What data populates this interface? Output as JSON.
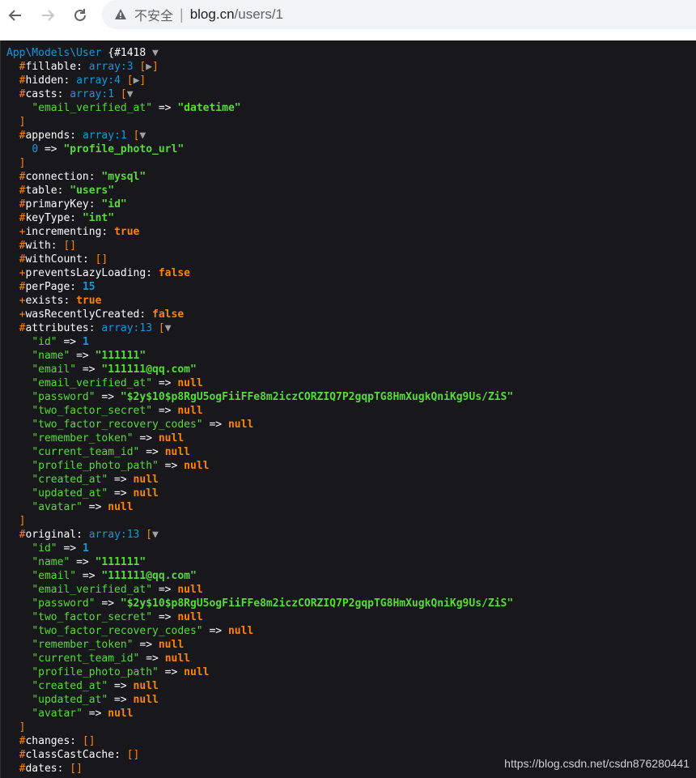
{
  "browser": {
    "security_label": "不安全",
    "url_host": "blog.cn",
    "url_path": "/users/1"
  },
  "dump": {
    "class_name": "App\\Models\\User",
    "object_id": "#1418",
    "lines": [
      {
        "indent": 0,
        "segments": [
          {
            "c": "cls",
            "t": "App\\Models\\User"
          },
          {
            "c": "def",
            "t": " {"
          },
          {
            "c": "prop",
            "t": "#1418"
          },
          {
            "c": "toggle",
            "t": " ▼"
          }
        ]
      },
      {
        "indent": 1,
        "segments": [
          {
            "c": "punct",
            "t": "#"
          },
          {
            "c": "prop",
            "t": "fillable"
          },
          {
            "c": "def",
            "t": ": "
          },
          {
            "c": "note",
            "t": "array:3"
          },
          {
            "c": "def",
            "t": " "
          },
          {
            "c": "punct",
            "t": "["
          },
          {
            "c": "toggle",
            "t": "▶"
          },
          {
            "c": "punct",
            "t": "]"
          }
        ]
      },
      {
        "indent": 1,
        "segments": [
          {
            "c": "punct",
            "t": "#"
          },
          {
            "c": "prop",
            "t": "hidden"
          },
          {
            "c": "def",
            "t": ": "
          },
          {
            "c": "note",
            "t": "array:4"
          },
          {
            "c": "def",
            "t": " "
          },
          {
            "c": "punct",
            "t": "["
          },
          {
            "c": "toggle",
            "t": "▶"
          },
          {
            "c": "punct",
            "t": "]"
          }
        ]
      },
      {
        "indent": 1,
        "segments": [
          {
            "c": "punct",
            "t": "#"
          },
          {
            "c": "prop",
            "t": "casts"
          },
          {
            "c": "def",
            "t": ": "
          },
          {
            "c": "note",
            "t": "array:1"
          },
          {
            "c": "def",
            "t": " "
          },
          {
            "c": "punct",
            "t": "["
          },
          {
            "c": "toggle",
            "t": "▼"
          }
        ]
      },
      {
        "indent": 2,
        "segments": [
          {
            "c": "key",
            "t": "\"email_verified_at\""
          },
          {
            "c": "def",
            "t": " => "
          },
          {
            "c": "str",
            "t": "\"datetime\""
          }
        ]
      },
      {
        "indent": 1,
        "segments": [
          {
            "c": "punct",
            "t": "]"
          }
        ]
      },
      {
        "indent": 1,
        "segments": [
          {
            "c": "punct",
            "t": "#"
          },
          {
            "c": "prop",
            "t": "appends"
          },
          {
            "c": "def",
            "t": ": "
          },
          {
            "c": "note",
            "t": "array:1"
          },
          {
            "c": "def",
            "t": " "
          },
          {
            "c": "punct",
            "t": "["
          },
          {
            "c": "toggle",
            "t": "▼"
          }
        ]
      },
      {
        "indent": 2,
        "segments": [
          {
            "c": "idx",
            "t": "0"
          },
          {
            "c": "def",
            "t": " => "
          },
          {
            "c": "str",
            "t": "\"profile_photo_url\""
          }
        ]
      },
      {
        "indent": 1,
        "segments": [
          {
            "c": "punct",
            "t": "]"
          }
        ]
      },
      {
        "indent": 1,
        "segments": [
          {
            "c": "punct",
            "t": "#"
          },
          {
            "c": "prop",
            "t": "connection"
          },
          {
            "c": "def",
            "t": ": "
          },
          {
            "c": "str",
            "t": "\"mysql\""
          }
        ]
      },
      {
        "indent": 1,
        "segments": [
          {
            "c": "punct",
            "t": "#"
          },
          {
            "c": "prop",
            "t": "table"
          },
          {
            "c": "def",
            "t": ": "
          },
          {
            "c": "str",
            "t": "\"users\""
          }
        ]
      },
      {
        "indent": 1,
        "segments": [
          {
            "c": "punct",
            "t": "#"
          },
          {
            "c": "prop",
            "t": "primaryKey"
          },
          {
            "c": "def",
            "t": ": "
          },
          {
            "c": "str",
            "t": "\"id\""
          }
        ]
      },
      {
        "indent": 1,
        "segments": [
          {
            "c": "punct",
            "t": "#"
          },
          {
            "c": "prop",
            "t": "keyType"
          },
          {
            "c": "def",
            "t": ": "
          },
          {
            "c": "str",
            "t": "\"int\""
          }
        ]
      },
      {
        "indent": 1,
        "segments": [
          {
            "c": "punct",
            "t": "+"
          },
          {
            "c": "prop",
            "t": "incrementing"
          },
          {
            "c": "def",
            "t": ": "
          },
          {
            "c": "const",
            "t": "true"
          }
        ]
      },
      {
        "indent": 1,
        "segments": [
          {
            "c": "punct",
            "t": "#"
          },
          {
            "c": "prop",
            "t": "with"
          },
          {
            "c": "def",
            "t": ": "
          },
          {
            "c": "punct",
            "t": "[]"
          }
        ]
      },
      {
        "indent": 1,
        "segments": [
          {
            "c": "punct",
            "t": "#"
          },
          {
            "c": "prop",
            "t": "withCount"
          },
          {
            "c": "def",
            "t": ": "
          },
          {
            "c": "punct",
            "t": "[]"
          }
        ]
      },
      {
        "indent": 1,
        "segments": [
          {
            "c": "punct",
            "t": "+"
          },
          {
            "c": "prop",
            "t": "preventsLazyLoading"
          },
          {
            "c": "def",
            "t": ": "
          },
          {
            "c": "const",
            "t": "false"
          }
        ]
      },
      {
        "indent": 1,
        "segments": [
          {
            "c": "punct",
            "t": "#"
          },
          {
            "c": "prop",
            "t": "perPage"
          },
          {
            "c": "def",
            "t": ": "
          },
          {
            "c": "num",
            "t": "15"
          }
        ]
      },
      {
        "indent": 1,
        "segments": [
          {
            "c": "punct",
            "t": "+"
          },
          {
            "c": "prop",
            "t": "exists"
          },
          {
            "c": "def",
            "t": ": "
          },
          {
            "c": "const",
            "t": "true"
          }
        ]
      },
      {
        "indent": 1,
        "segments": [
          {
            "c": "punct",
            "t": "+"
          },
          {
            "c": "prop",
            "t": "wasRecentlyCreated"
          },
          {
            "c": "def",
            "t": ": "
          },
          {
            "c": "const",
            "t": "false"
          }
        ]
      },
      {
        "indent": 1,
        "segments": [
          {
            "c": "punct",
            "t": "#"
          },
          {
            "c": "prop",
            "t": "attributes"
          },
          {
            "c": "def",
            "t": ": "
          },
          {
            "c": "note",
            "t": "array:13"
          },
          {
            "c": "def",
            "t": " "
          },
          {
            "c": "punct",
            "t": "["
          },
          {
            "c": "toggle",
            "t": "▼"
          }
        ]
      },
      {
        "indent": 2,
        "segments": [
          {
            "c": "key",
            "t": "\"id\""
          },
          {
            "c": "def",
            "t": " => "
          },
          {
            "c": "num",
            "t": "1"
          }
        ]
      },
      {
        "indent": 2,
        "segments": [
          {
            "c": "key",
            "t": "\"name\""
          },
          {
            "c": "def",
            "t": " => "
          },
          {
            "c": "str",
            "t": "\"111111\""
          }
        ]
      },
      {
        "indent": 2,
        "segments": [
          {
            "c": "key",
            "t": "\"email\""
          },
          {
            "c": "def",
            "t": " => "
          },
          {
            "c": "str",
            "t": "\"111111@qq.com\""
          }
        ]
      },
      {
        "indent": 2,
        "segments": [
          {
            "c": "key",
            "t": "\"email_verified_at\""
          },
          {
            "c": "def",
            "t": " => "
          },
          {
            "c": "const",
            "t": "null"
          }
        ]
      },
      {
        "indent": 2,
        "segments": [
          {
            "c": "key",
            "t": "\"password\""
          },
          {
            "c": "def",
            "t": " => "
          },
          {
            "c": "str",
            "t": "\"$2y$10$p8RgU5ogFiiFFe8m2iczCORZIQ7P2gqpTG8HmXugkQniKg9Us/ZiS\""
          }
        ]
      },
      {
        "indent": 2,
        "segments": [
          {
            "c": "key",
            "t": "\"two_factor_secret\""
          },
          {
            "c": "def",
            "t": " => "
          },
          {
            "c": "const",
            "t": "null"
          }
        ]
      },
      {
        "indent": 2,
        "segments": [
          {
            "c": "key",
            "t": "\"two_factor_recovery_codes\""
          },
          {
            "c": "def",
            "t": " => "
          },
          {
            "c": "const",
            "t": "null"
          }
        ]
      },
      {
        "indent": 2,
        "segments": [
          {
            "c": "key",
            "t": "\"remember_token\""
          },
          {
            "c": "def",
            "t": " => "
          },
          {
            "c": "const",
            "t": "null"
          }
        ]
      },
      {
        "indent": 2,
        "segments": [
          {
            "c": "key",
            "t": "\"current_team_id\""
          },
          {
            "c": "def",
            "t": " => "
          },
          {
            "c": "const",
            "t": "null"
          }
        ]
      },
      {
        "indent": 2,
        "segments": [
          {
            "c": "key",
            "t": "\"profile_photo_path\""
          },
          {
            "c": "def",
            "t": " => "
          },
          {
            "c": "const",
            "t": "null"
          }
        ]
      },
      {
        "indent": 2,
        "segments": [
          {
            "c": "key",
            "t": "\"created_at\""
          },
          {
            "c": "def",
            "t": " => "
          },
          {
            "c": "const",
            "t": "null"
          }
        ]
      },
      {
        "indent": 2,
        "segments": [
          {
            "c": "key",
            "t": "\"updated_at\""
          },
          {
            "c": "def",
            "t": " => "
          },
          {
            "c": "const",
            "t": "null"
          }
        ]
      },
      {
        "indent": 2,
        "segments": [
          {
            "c": "key",
            "t": "\"avatar\""
          },
          {
            "c": "def",
            "t": " => "
          },
          {
            "c": "const",
            "t": "null"
          }
        ]
      },
      {
        "indent": 1,
        "segments": [
          {
            "c": "punct",
            "t": "]"
          }
        ]
      },
      {
        "indent": 1,
        "segments": [
          {
            "c": "punct",
            "t": "#"
          },
          {
            "c": "prop",
            "t": "original"
          },
          {
            "c": "def",
            "t": ": "
          },
          {
            "c": "note",
            "t": "array:13"
          },
          {
            "c": "def",
            "t": " "
          },
          {
            "c": "punct",
            "t": "["
          },
          {
            "c": "toggle",
            "t": "▼"
          }
        ]
      },
      {
        "indent": 2,
        "segments": [
          {
            "c": "key",
            "t": "\"id\""
          },
          {
            "c": "def",
            "t": " => "
          },
          {
            "c": "num",
            "t": "1"
          }
        ]
      },
      {
        "indent": 2,
        "segments": [
          {
            "c": "key",
            "t": "\"name\""
          },
          {
            "c": "def",
            "t": " => "
          },
          {
            "c": "str",
            "t": "\"111111\""
          }
        ]
      },
      {
        "indent": 2,
        "segments": [
          {
            "c": "key",
            "t": "\"email\""
          },
          {
            "c": "def",
            "t": " => "
          },
          {
            "c": "str",
            "t": "\"111111@qq.com\""
          }
        ]
      },
      {
        "indent": 2,
        "segments": [
          {
            "c": "key",
            "t": "\"email_verified_at\""
          },
          {
            "c": "def",
            "t": " => "
          },
          {
            "c": "const",
            "t": "null"
          }
        ]
      },
      {
        "indent": 2,
        "segments": [
          {
            "c": "key",
            "t": "\"password\""
          },
          {
            "c": "def",
            "t": " => "
          },
          {
            "c": "str",
            "t": "\"$2y$10$p8RgU5ogFiiFFe8m2iczCORZIQ7P2gqpTG8HmXugkQniKg9Us/ZiS\""
          }
        ]
      },
      {
        "indent": 2,
        "segments": [
          {
            "c": "key",
            "t": "\"two_factor_secret\""
          },
          {
            "c": "def",
            "t": " => "
          },
          {
            "c": "const",
            "t": "null"
          }
        ]
      },
      {
        "indent": 2,
        "segments": [
          {
            "c": "key",
            "t": "\"two_factor_recovery_codes\""
          },
          {
            "c": "def",
            "t": " => "
          },
          {
            "c": "const",
            "t": "null"
          }
        ]
      },
      {
        "indent": 2,
        "segments": [
          {
            "c": "key",
            "t": "\"remember_token\""
          },
          {
            "c": "def",
            "t": " => "
          },
          {
            "c": "const",
            "t": "null"
          }
        ]
      },
      {
        "indent": 2,
        "segments": [
          {
            "c": "key",
            "t": "\"current_team_id\""
          },
          {
            "c": "def",
            "t": " => "
          },
          {
            "c": "const",
            "t": "null"
          }
        ]
      },
      {
        "indent": 2,
        "segments": [
          {
            "c": "key",
            "t": "\"profile_photo_path\""
          },
          {
            "c": "def",
            "t": " => "
          },
          {
            "c": "const",
            "t": "null"
          }
        ]
      },
      {
        "indent": 2,
        "segments": [
          {
            "c": "key",
            "t": "\"created_at\""
          },
          {
            "c": "def",
            "t": " => "
          },
          {
            "c": "const",
            "t": "null"
          }
        ]
      },
      {
        "indent": 2,
        "segments": [
          {
            "c": "key",
            "t": "\"updated_at\""
          },
          {
            "c": "def",
            "t": " => "
          },
          {
            "c": "const",
            "t": "null"
          }
        ]
      },
      {
        "indent": 2,
        "segments": [
          {
            "c": "key",
            "t": "\"avatar\""
          },
          {
            "c": "def",
            "t": " => "
          },
          {
            "c": "const",
            "t": "null"
          }
        ]
      },
      {
        "indent": 1,
        "segments": [
          {
            "c": "punct",
            "t": "]"
          }
        ]
      },
      {
        "indent": 1,
        "segments": [
          {
            "c": "punct",
            "t": "#"
          },
          {
            "c": "prop",
            "t": "changes"
          },
          {
            "c": "def",
            "t": ": "
          },
          {
            "c": "punct",
            "t": "[]"
          }
        ]
      },
      {
        "indent": 1,
        "segments": [
          {
            "c": "punct",
            "t": "#"
          },
          {
            "c": "prop",
            "t": "classCastCache"
          },
          {
            "c": "def",
            "t": ": "
          },
          {
            "c": "punct",
            "t": "[]"
          }
        ]
      },
      {
        "indent": 1,
        "segments": [
          {
            "c": "punct",
            "t": "#"
          },
          {
            "c": "prop",
            "t": "dates"
          },
          {
            "c": "def",
            "t": ": "
          },
          {
            "c": "punct",
            "t": "[]"
          }
        ]
      }
    ]
  },
  "watermark": "https://blog.csdn.net/csdn876280441",
  "colors": {
    "dump_background": "#18171b",
    "class": "#1299DA",
    "key": "#56DB3A",
    "constant": "#FF8400",
    "omnibox": "#f1f3f4"
  }
}
